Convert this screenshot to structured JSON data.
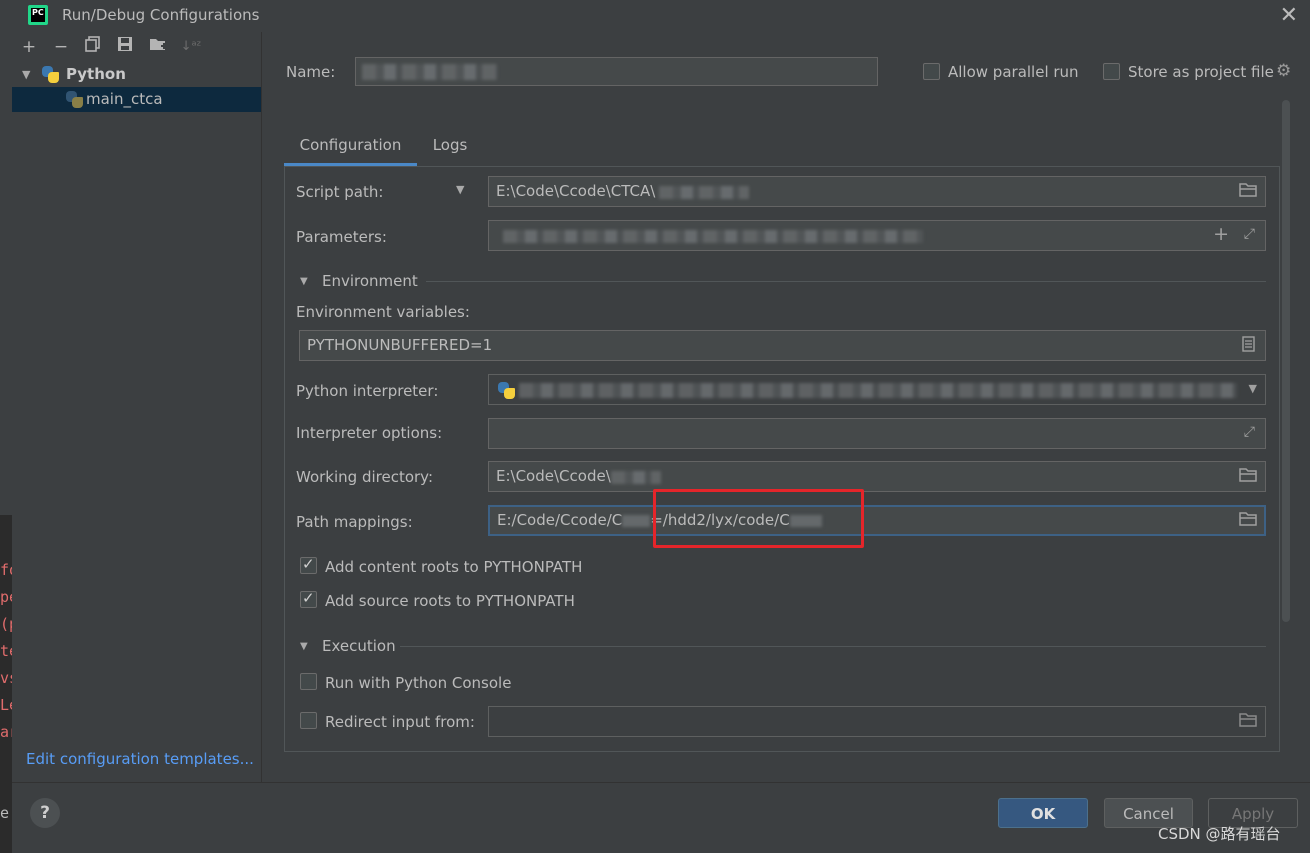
{
  "editor_bleed": [
    "fo",
    "pe",
    "(p",
    "te",
    "vs",
    "Le",
    "ar"
  ],
  "editor_bleed_bottom": "e",
  "dialog": {
    "title": "Run/Debug Configurations",
    "app_icon_text": "PC"
  },
  "toolbar": {
    "add": "+",
    "remove": "−",
    "copy": "⧉",
    "save": "💾",
    "folder": "📁",
    "sort": "↓ᵃᶻ"
  },
  "tree": {
    "root_label": "Python",
    "child_label": "main_ctca"
  },
  "edit_templates_link": "Edit configuration templates...",
  "header": {
    "name_label": "Name:",
    "name_value": "",
    "allow_parallel_label": "Allow parallel run",
    "allow_parallel_checked": false,
    "store_project_label": "Store as project file",
    "store_project_checked": false
  },
  "tabs": [
    {
      "label": "Configuration",
      "active": true
    },
    {
      "label": "Logs",
      "active": false
    }
  ],
  "config": {
    "script_path_label": "Script path:",
    "script_path_value": "E:\\Code\\Ccode\\CTCA\\",
    "parameters_label": "Parameters:",
    "parameters_value": "",
    "environment_section": "Environment",
    "env_vars_label": "Environment variables:",
    "env_vars_value": "PYTHONUNBUFFERED=1",
    "interpreter_label": "Python interpreter:",
    "interpreter_value": "",
    "interpreter_options_label": "Interpreter options:",
    "interpreter_options_value": "",
    "working_dir_label": "Working directory:",
    "working_dir_value": "E:\\Code\\Ccode\\",
    "path_mappings_label": "Path mappings:",
    "path_mappings_value_a": "E:/Code/Ccode/C",
    "path_mappings_value_b": "=/hdd2/lyx/code/C",
    "add_content_roots_label": "Add content roots to PYTHONPATH",
    "add_content_roots_checked": true,
    "add_source_roots_label": "Add source roots to PYTHONPATH",
    "add_source_roots_checked": true,
    "execution_section": "Execution",
    "run_console_label": "Run with Python Console",
    "run_console_checked": false,
    "redirect_input_label": "Redirect input from:",
    "redirect_input_checked": false,
    "redirect_input_value": ""
  },
  "buttons": {
    "help": "?",
    "ok": "OK",
    "cancel": "Cancel",
    "apply": "Apply"
  },
  "watermark": "CSDN @路有瑶台",
  "colors": {
    "background": "#3c3f41",
    "field_bg": "#45494a",
    "accent_blue": "#4a88c7",
    "link": "#589df6",
    "highlight_box": "#e5252a",
    "ok_button": "#365880"
  },
  "icons": {
    "browse": "folder-icon",
    "expand": "expand-icon",
    "add": "plus-icon",
    "document": "document-icon",
    "dropdown": "chevron-down-icon",
    "gear": "gear-icon"
  }
}
